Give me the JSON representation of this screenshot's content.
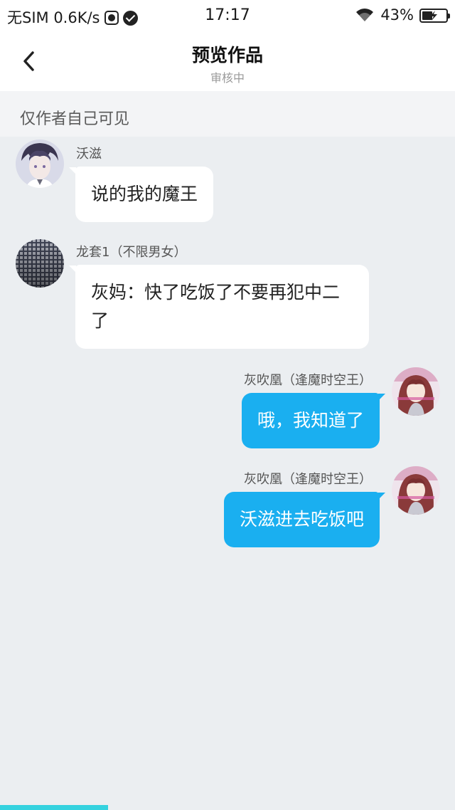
{
  "status_bar": {
    "left_text": "无SIM 0.6K/s",
    "time": "17:17",
    "battery_percent": "43%",
    "battery_level": 0.43,
    "charging": true
  },
  "header": {
    "title": "预览作品",
    "subtitle": "审核中",
    "back_icon": "chevron-left-icon"
  },
  "notice": {
    "text": "仅作者自己可见"
  },
  "messages": [
    {
      "side": "left",
      "sender": "沃滋",
      "text": "说的我的魔王"
    },
    {
      "side": "left",
      "sender": "龙套1（不限男女）",
      "text": "灰妈：快了吃饭了不要再犯中二了"
    },
    {
      "side": "right",
      "sender": "灰吹凰（逢魔时空王）",
      "text": "哦，我知道了"
    },
    {
      "side": "right",
      "sender": "灰吹凰（逢魔时空王）",
      "text": "沃滋进去吃饭吧"
    }
  ],
  "colors": {
    "accent_bubble": "#1aaff0",
    "background": "#ebeef1",
    "progress": "#34d2df"
  }
}
